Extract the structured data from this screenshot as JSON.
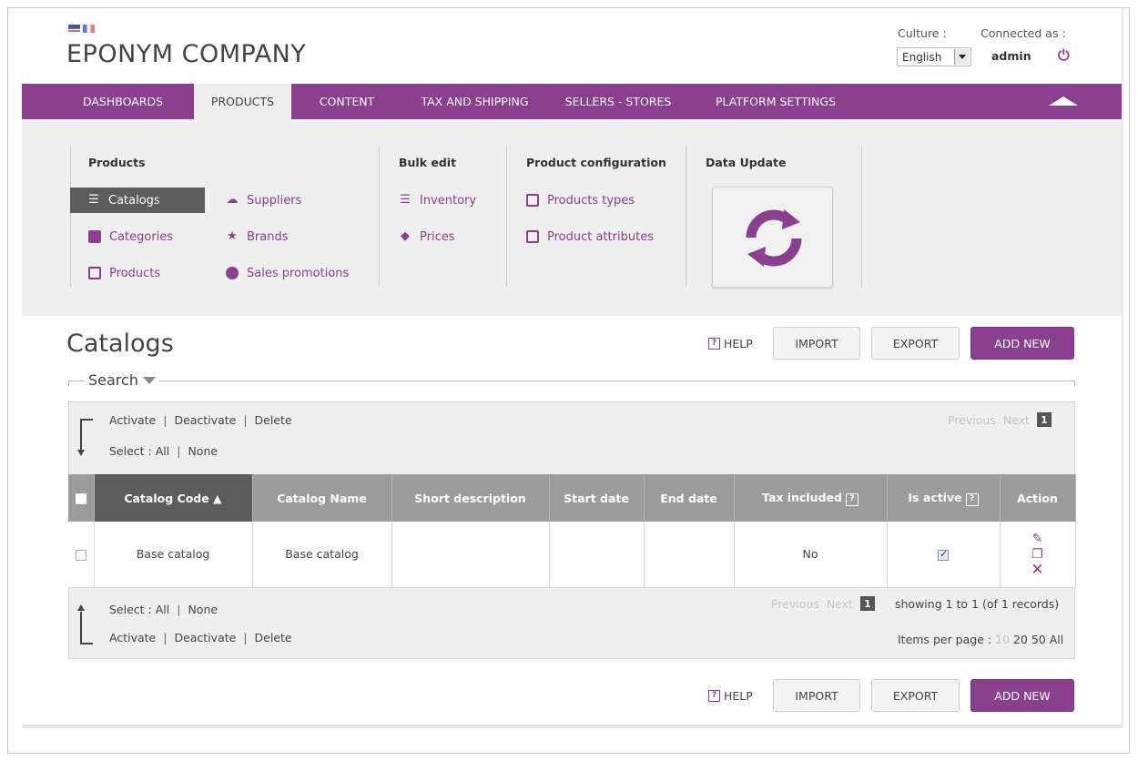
{
  "header": {
    "company": "EPONYM COMPANY",
    "culture_label": "Culture :",
    "language": "English",
    "connected_label": "Connected as :",
    "user": "admin"
  },
  "nav": {
    "items": [
      "DASHBOARDS",
      "PRODUCTS",
      "CONTENT",
      "TAX AND SHIPPING",
      "SELLERS - STORES",
      "PLATFORM SETTINGS"
    ],
    "active": "PRODUCTS"
  },
  "submenu": {
    "products_title": "Products",
    "catalogs": "Catalogs",
    "categories": "Categories",
    "products": "Products",
    "suppliers": "Suppliers",
    "brands": "Brands",
    "sales_promotions": "Sales promotions",
    "bulk_title": "Bulk edit",
    "inventory": "Inventory",
    "prices": "Prices",
    "config_title": "Product configuration",
    "product_types": "Products types",
    "product_attributes": "Product attributes",
    "data_update_title": "Data Update"
  },
  "page": {
    "title": "Catalogs",
    "help": "HELP",
    "import": "IMPORT",
    "export": "EXPORT",
    "add_new": "ADD NEW",
    "search": "Search"
  },
  "bulk": {
    "activate": "Activate",
    "deactivate": "Deactivate",
    "delete": "Delete",
    "select_label": "Select :",
    "all": "All",
    "none": "None",
    "previous": "Previous",
    "next": "Next",
    "page": "1",
    "showing": "showing 1 to 1 (of 1 records)",
    "ipp_label": "Items per page :",
    "ipp_10": "10",
    "ipp_20": "20",
    "ipp_50": "50",
    "ipp_all": "All"
  },
  "table": {
    "columns": [
      "Catalog Code ▲",
      "Catalog Name",
      "Short description",
      "Start date",
      "End date",
      "Tax included",
      "Is active",
      "Action"
    ],
    "row": {
      "code": "Base catalog",
      "name": "Base catalog",
      "short_description": "",
      "start_date": "",
      "end_date": "",
      "tax_included": "No",
      "is_active": true
    }
  },
  "colors": {
    "accent": "#8b3f8f",
    "panel": "#efefef",
    "header_gray": "#9c9c9c",
    "sorted_header": "#5c5c5c"
  }
}
